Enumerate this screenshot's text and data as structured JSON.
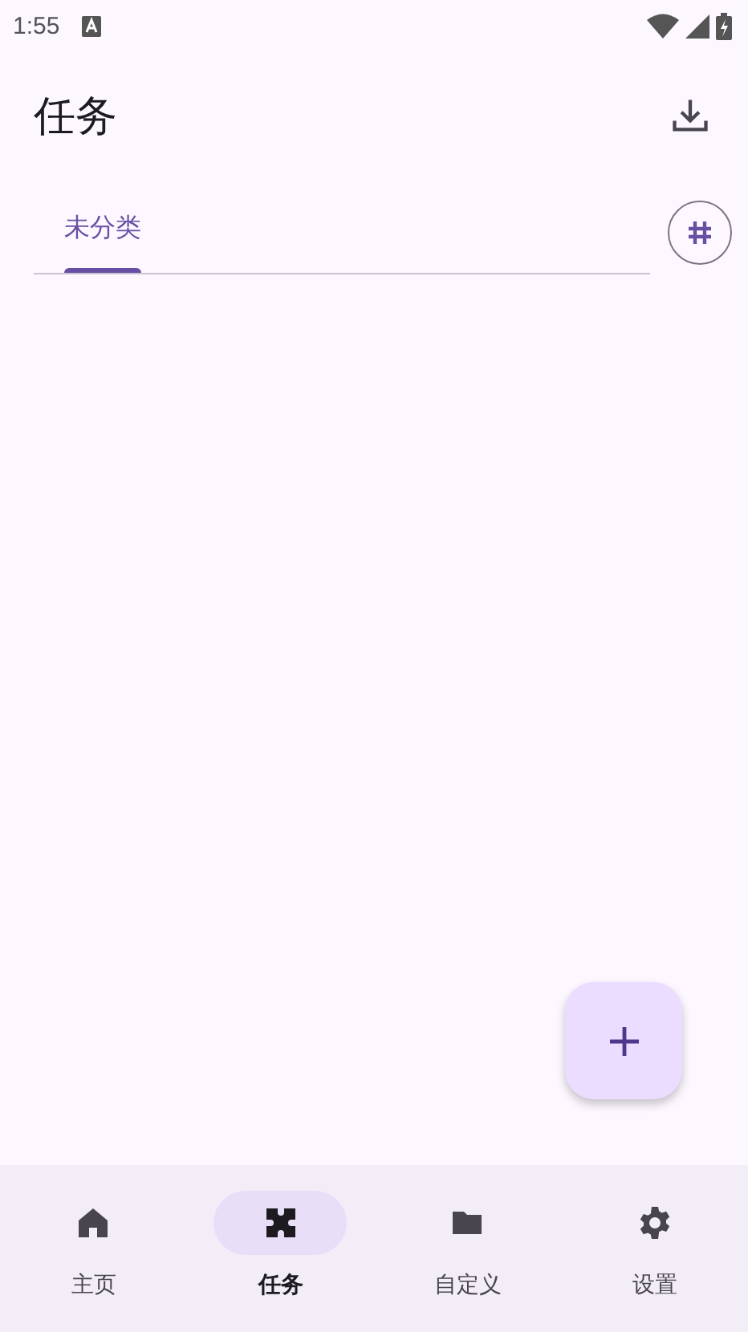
{
  "status_bar": {
    "time": "1:55"
  },
  "app_bar": {
    "title": "任务"
  },
  "tabs": [
    {
      "label": "未分类",
      "selected": true
    }
  ],
  "bottom_nav": [
    {
      "label": "主页",
      "selected": false
    },
    {
      "label": "任务",
      "selected": true
    },
    {
      "label": "自定义",
      "selected": false
    },
    {
      "label": "设置",
      "selected": false
    }
  ]
}
